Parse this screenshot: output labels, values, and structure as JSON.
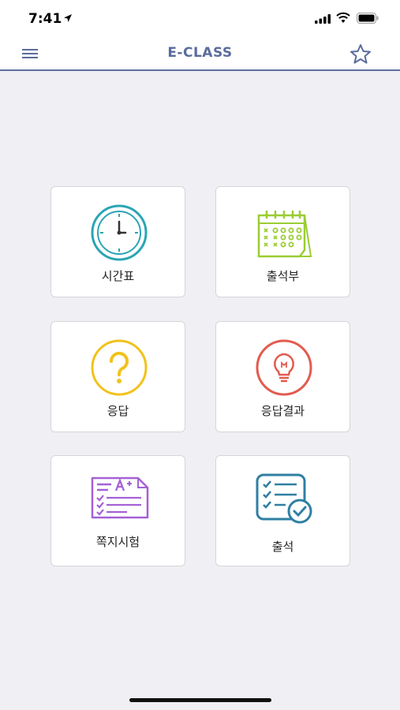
{
  "status_bar": {
    "time": "7:41"
  },
  "nav": {
    "title": "E-CLASS",
    "menu_icon": "hamburger-menu-icon",
    "favorite_icon": "star-outline-icon"
  },
  "menu_items": [
    {
      "label": "시간표",
      "icon": "clock-icon",
      "color": "#2aa5b3"
    },
    {
      "label": "출석부",
      "icon": "calendar-icon",
      "color": "#9acd32"
    },
    {
      "label": "응답",
      "icon": "question-mark-icon",
      "color": "#f2c21b"
    },
    {
      "label": "응답결과",
      "icon": "lightbulb-icon",
      "color": "#e25b4f"
    },
    {
      "label": "쪽지시험",
      "icon": "quiz-sheet-icon",
      "color": "#a561d6"
    },
    {
      "label": "출석",
      "icon": "checklist-icon",
      "color": "#2f7fa3"
    }
  ],
  "colors": {
    "accent": "#5b6c9c",
    "background": "#efeff4",
    "card": "#ffffff"
  }
}
